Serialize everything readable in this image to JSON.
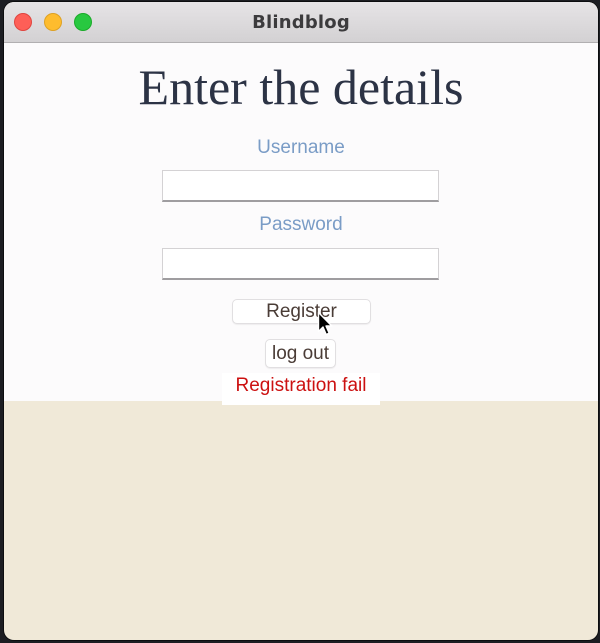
{
  "window": {
    "title": "Blindblog"
  },
  "form": {
    "heading": "Enter the details",
    "username_label": "Username",
    "username_value": "",
    "password_label": "Password",
    "password_value": "",
    "register_label": "Register",
    "logout_label": "log out",
    "status_message": "Registration fail"
  },
  "colors": {
    "label": "#7a9cc6",
    "error": "#cc1111",
    "heading": "#2c3345",
    "lower_background": "#f0e9d8"
  },
  "icons": [
    "close-window-icon",
    "minimize-window-icon",
    "zoom-window-icon",
    "mouse-pointer-icon"
  ]
}
